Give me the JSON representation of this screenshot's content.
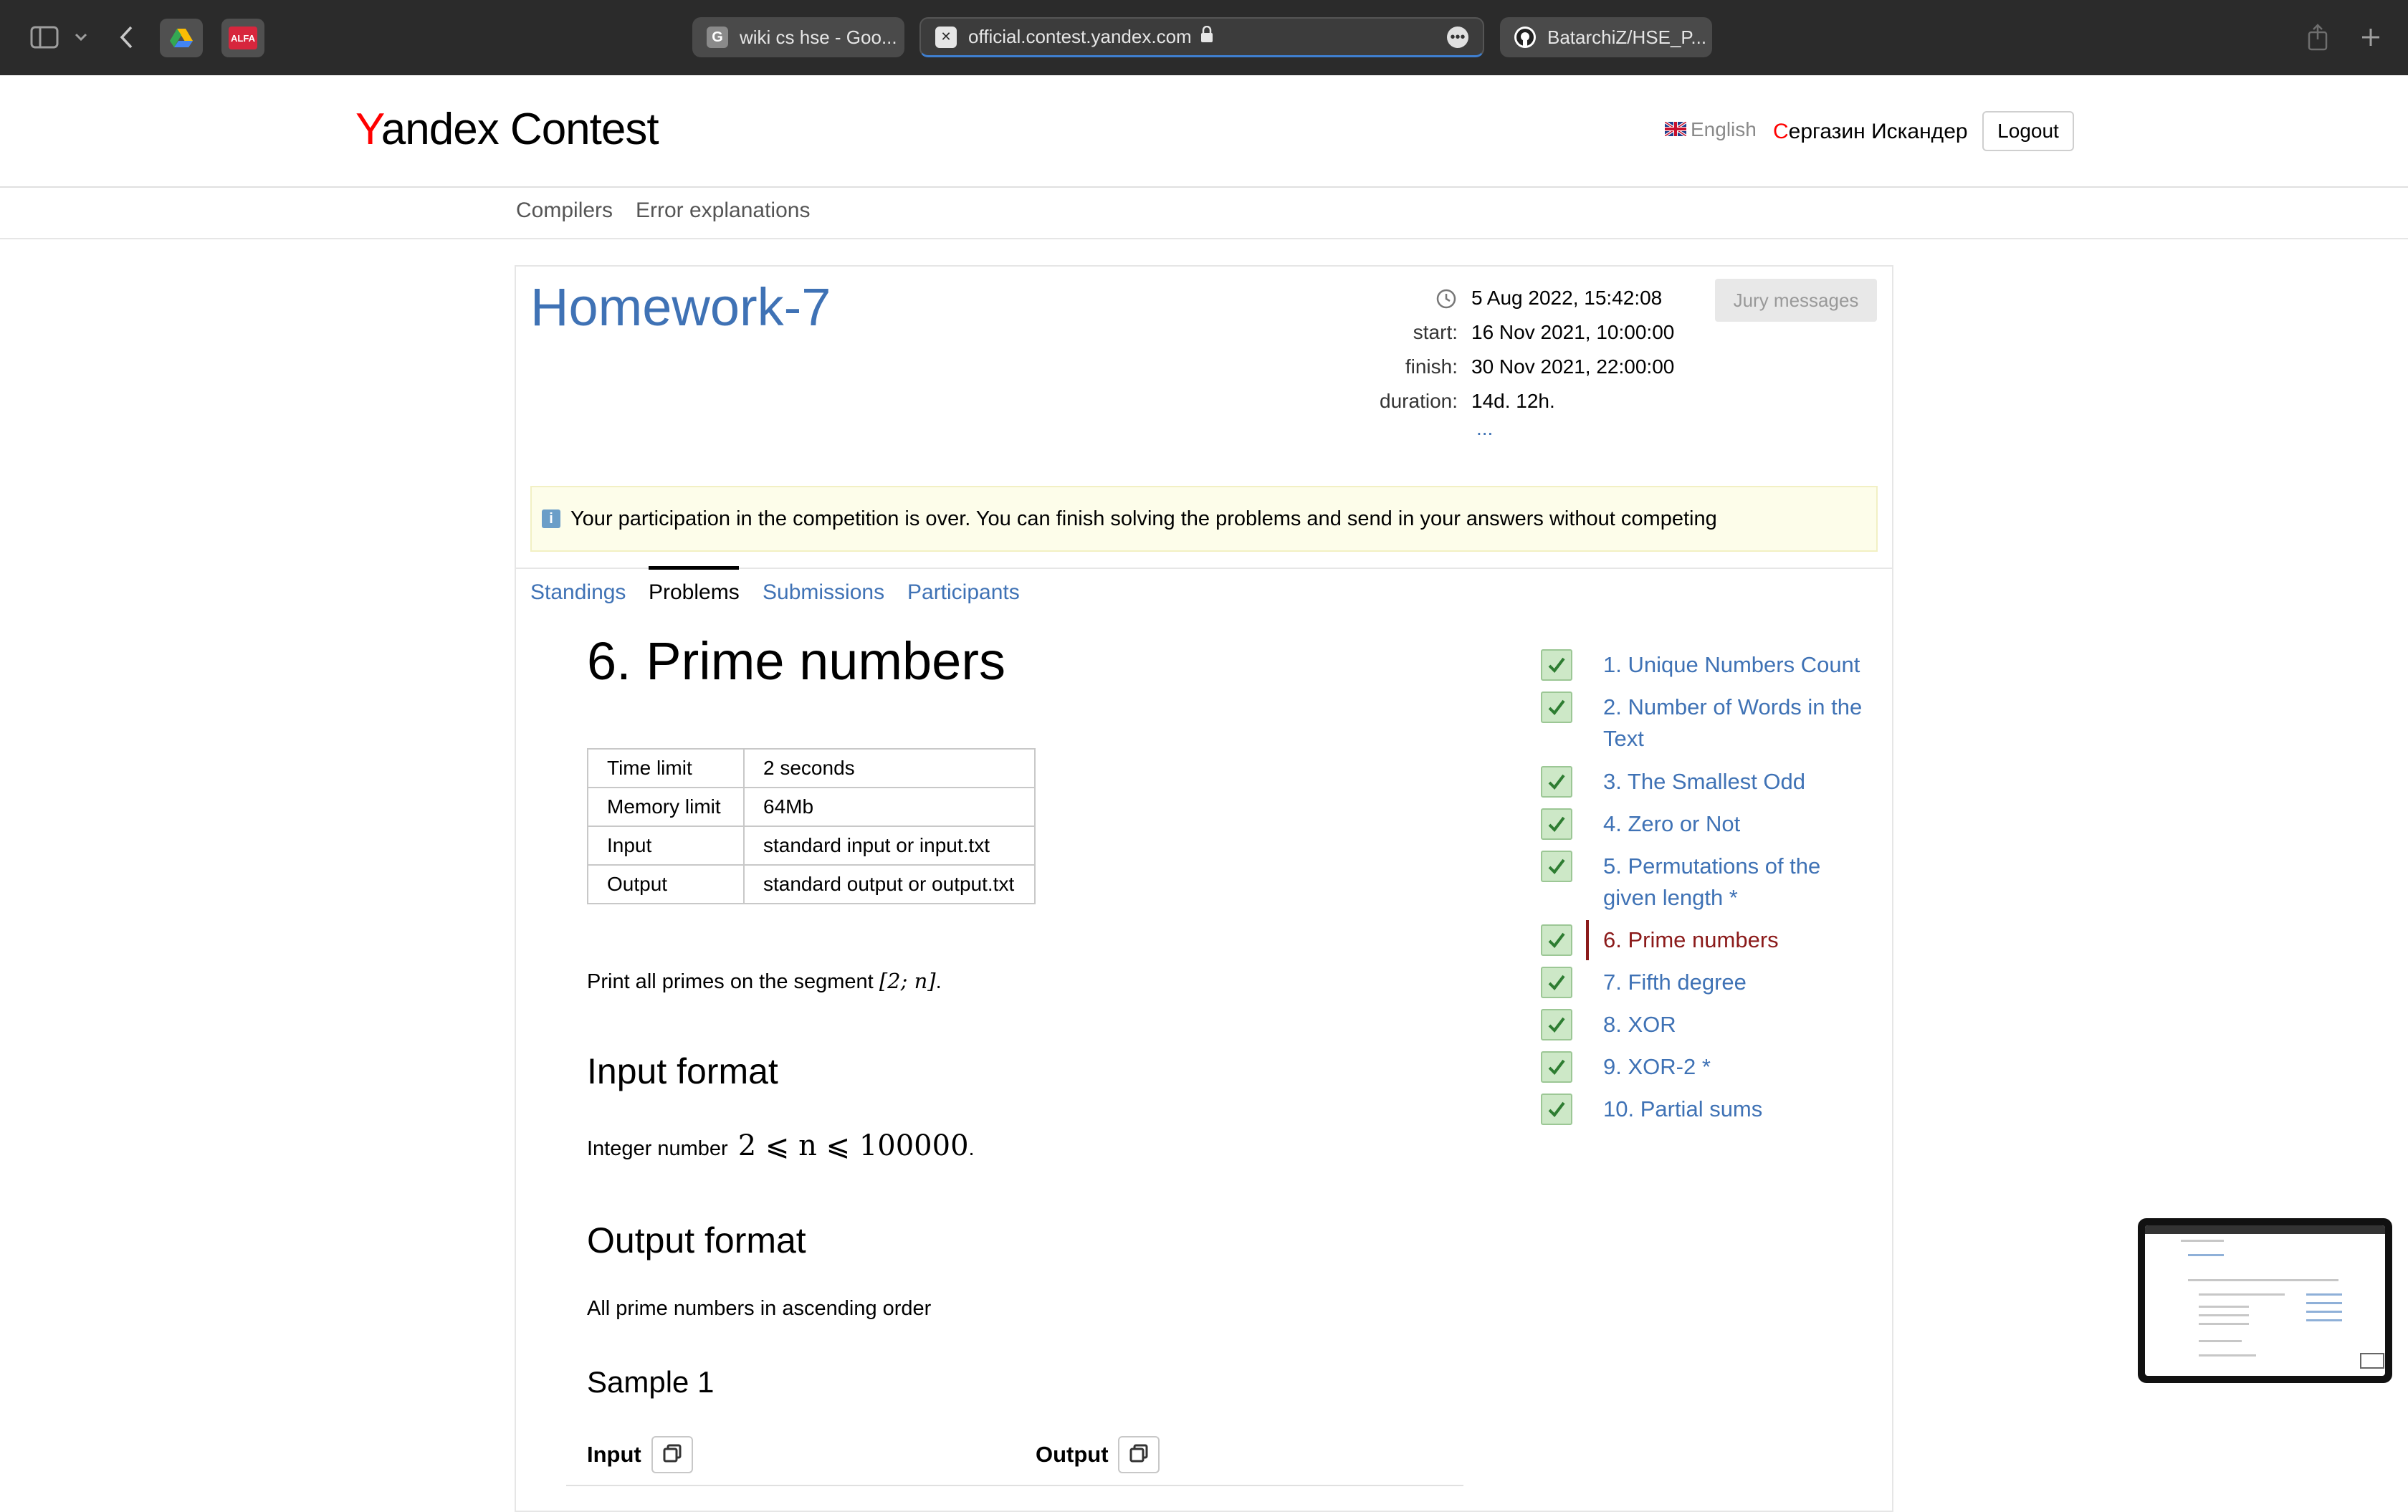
{
  "browser": {
    "tabs": [
      {
        "label": "wiki cs hse - Goo...",
        "favicon": "G"
      },
      {
        "label": "official.contest.yandex.com",
        "favicon": "X",
        "active": true
      },
      {
        "label": "BatarchiZ/HSE_P...",
        "favicon": "github-icon"
      }
    ],
    "ext2_label": "ALFA"
  },
  "header": {
    "logo_y": "Y",
    "logo_rest": "andex Contest",
    "language": "English",
    "user_first": "С",
    "user_rest": "ергазин Искандер",
    "logout": "Logout"
  },
  "subnav": {
    "compilers": "Compilers",
    "errors": "Error explanations"
  },
  "contest": {
    "title": "Homework-7",
    "current_time": "5 Aug 2022, 15:42:08",
    "start_label": "start:",
    "start": "16 Nov 2021, 10:00:00",
    "finish_label": "finish:",
    "finish": "30 Nov 2021, 22:00:00",
    "duration_label": "duration:",
    "duration": "14d. 12h.",
    "more": "...",
    "jury_button": "Jury messages",
    "notice": "Your participation in the competition is over. You can finish solving the problems and send in your answers without competing",
    "tabs": [
      "Standings",
      "Problems",
      "Submissions",
      "Participants"
    ]
  },
  "problem": {
    "title": "6. Prime numbers",
    "limits": [
      {
        "name": "Time limit",
        "value": "2 seconds"
      },
      {
        "name": "Memory limit",
        "value": "64Mb"
      },
      {
        "name": "Input",
        "value": "standard input or input.txt"
      },
      {
        "name": "Output",
        "value": "standard output or output.txt"
      }
    ],
    "statement_prefix": "Print all primes on the segment",
    "statement_math": "[2; n]",
    "statement_suffix": ".",
    "input_heading": "Input format",
    "input_prefix": "Integer number",
    "input_math": "2 ⩽ n ⩽ 100000",
    "input_suffix": ".",
    "output_heading": "Output format",
    "output_text": "All prime numbers in ascending order",
    "sample_heading": "Sample 1",
    "sample_input": "Input",
    "sample_output": "Output"
  },
  "problem_list": [
    {
      "label": "1. Unique Numbers Count",
      "solved": true
    },
    {
      "label": "2. Number of Words in the Text",
      "solved": true
    },
    {
      "label": "3. The Smallest Odd",
      "solved": true
    },
    {
      "label": "4. Zero or Not",
      "solved": true
    },
    {
      "label": "5. Permutations of the given length *",
      "solved": true
    },
    {
      "label": "6. Prime numbers",
      "solved": true,
      "active": true
    },
    {
      "label": "7. Fifth degree",
      "solved": true
    },
    {
      "label": "8. XOR",
      "solved": true
    },
    {
      "label": "9. XOR-2 *",
      "solved": true
    },
    {
      "label": "10. Partial sums",
      "solved": true
    }
  ],
  "colors": {
    "link": "#3f72b5",
    "active_problem": "#8b1a1a",
    "logo_accent": "#ff0000",
    "check_bg": "#cde8c7",
    "check_mark": "#2e7d32"
  }
}
